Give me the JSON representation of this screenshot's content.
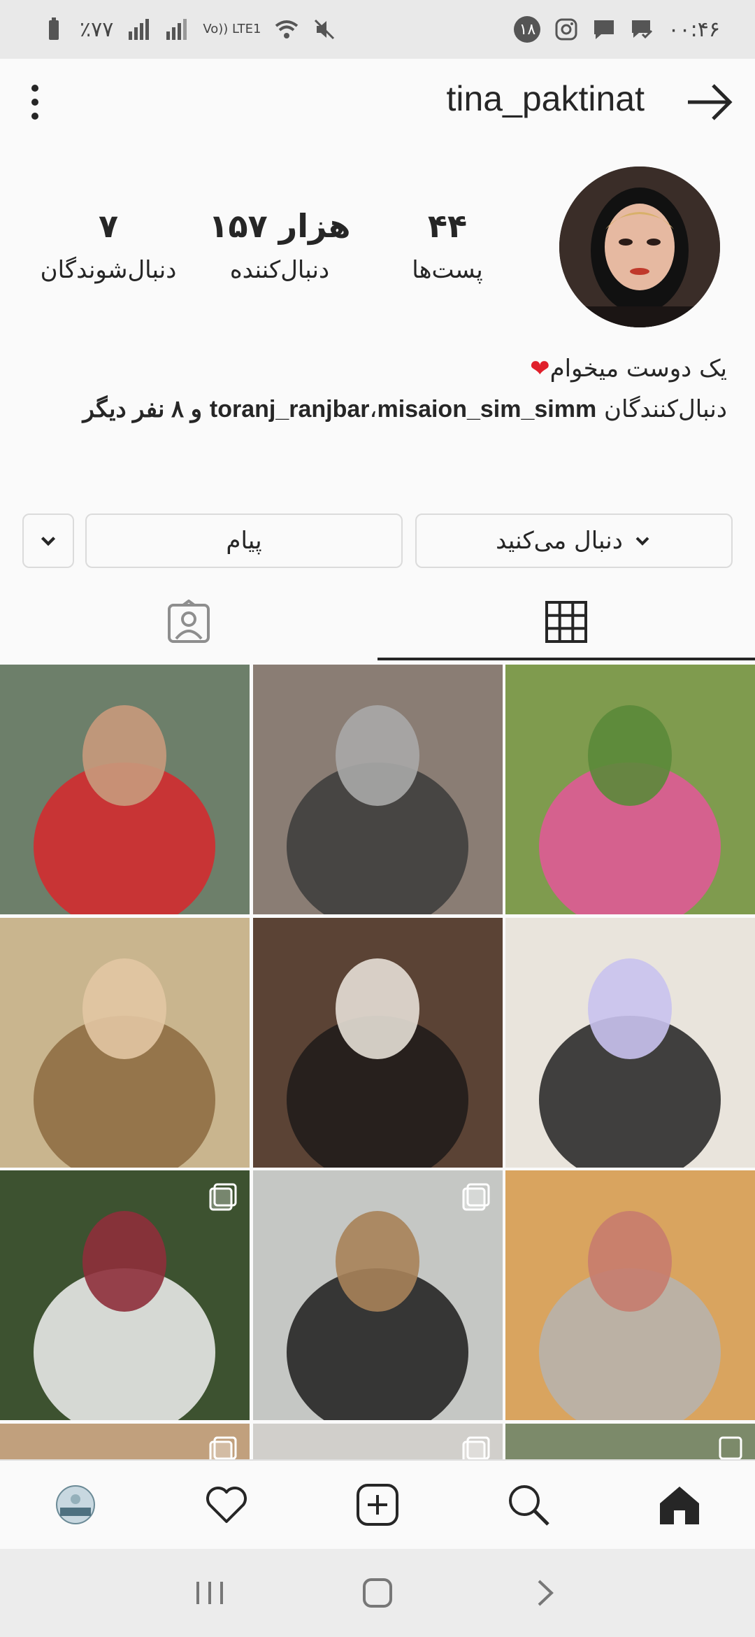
{
  "status_bar": {
    "battery": "٪۷۷",
    "network": "Vo)) LTE1",
    "notification_count": "۱۸",
    "time": "۰۰:۴۶"
  },
  "header": {
    "username": "tina_paktinat"
  },
  "profile": {
    "stats": [
      {
        "value": "۴۴",
        "label": "پست‌ها"
      },
      {
        "value": "۱۵۷ هزار",
        "label": "دنبال‌کننده"
      },
      {
        "value": "۷",
        "label": "دنبال‌شوندگان"
      }
    ],
    "bio_line": "یک دوست میخوام",
    "followed_by_prefix": "دنبال‌کنندگان",
    "followed_by_user1": "toranj_ranjbar",
    "followed_by_sep": "،",
    "followed_by_user2": "misaion_sim_simm",
    "followed_by_suffix": "و ۸ نفر دیگر"
  },
  "actions": {
    "following_label": "دنبال می‌کنید",
    "message_label": "پیام"
  },
  "grid": {
    "tiles": [
      {
        "colors": [
          "#6d7f6a",
          "#d8272b",
          "#c89a7c"
        ]
      },
      {
        "colors": [
          "#8a7d74",
          "#3b3b3b",
          "#a9a9a9"
        ]
      },
      {
        "colors": [
          "#7f9b4e",
          "#e4579a",
          "#5b8a3a"
        ]
      },
      {
        "colors": [
          "#c9b58e",
          "#8c6a3f",
          "#e2c7a3"
        ]
      },
      {
        "colors": [
          "#5b4335",
          "#1f1a19",
          "#e6dfd6"
        ]
      },
      {
        "colors": [
          "#e9e4dc",
          "#222222",
          "#c9c2ee"
        ]
      },
      {
        "colors": [
          "#3d5230",
          "#f1f1f1",
          "#8e2f3b"
        ]
      },
      {
        "colors": [
          "#c5c7c4",
          "#1c1c1c",
          "#a78259"
        ]
      },
      {
        "colors": [
          "#d9a45f",
          "#b5b4b0",
          "#c77c6e"
        ]
      },
      {
        "colors": [
          "#c1a07d",
          "#3b2f2a",
          "#eaeaea"
        ]
      },
      {
        "colors": [
          "#d1cfcb",
          "#b28c62",
          "#eeeeee"
        ]
      },
      {
        "colors": [
          "#7c8a6a",
          "#cfb18c",
          "#e7e3dc"
        ]
      }
    ]
  }
}
